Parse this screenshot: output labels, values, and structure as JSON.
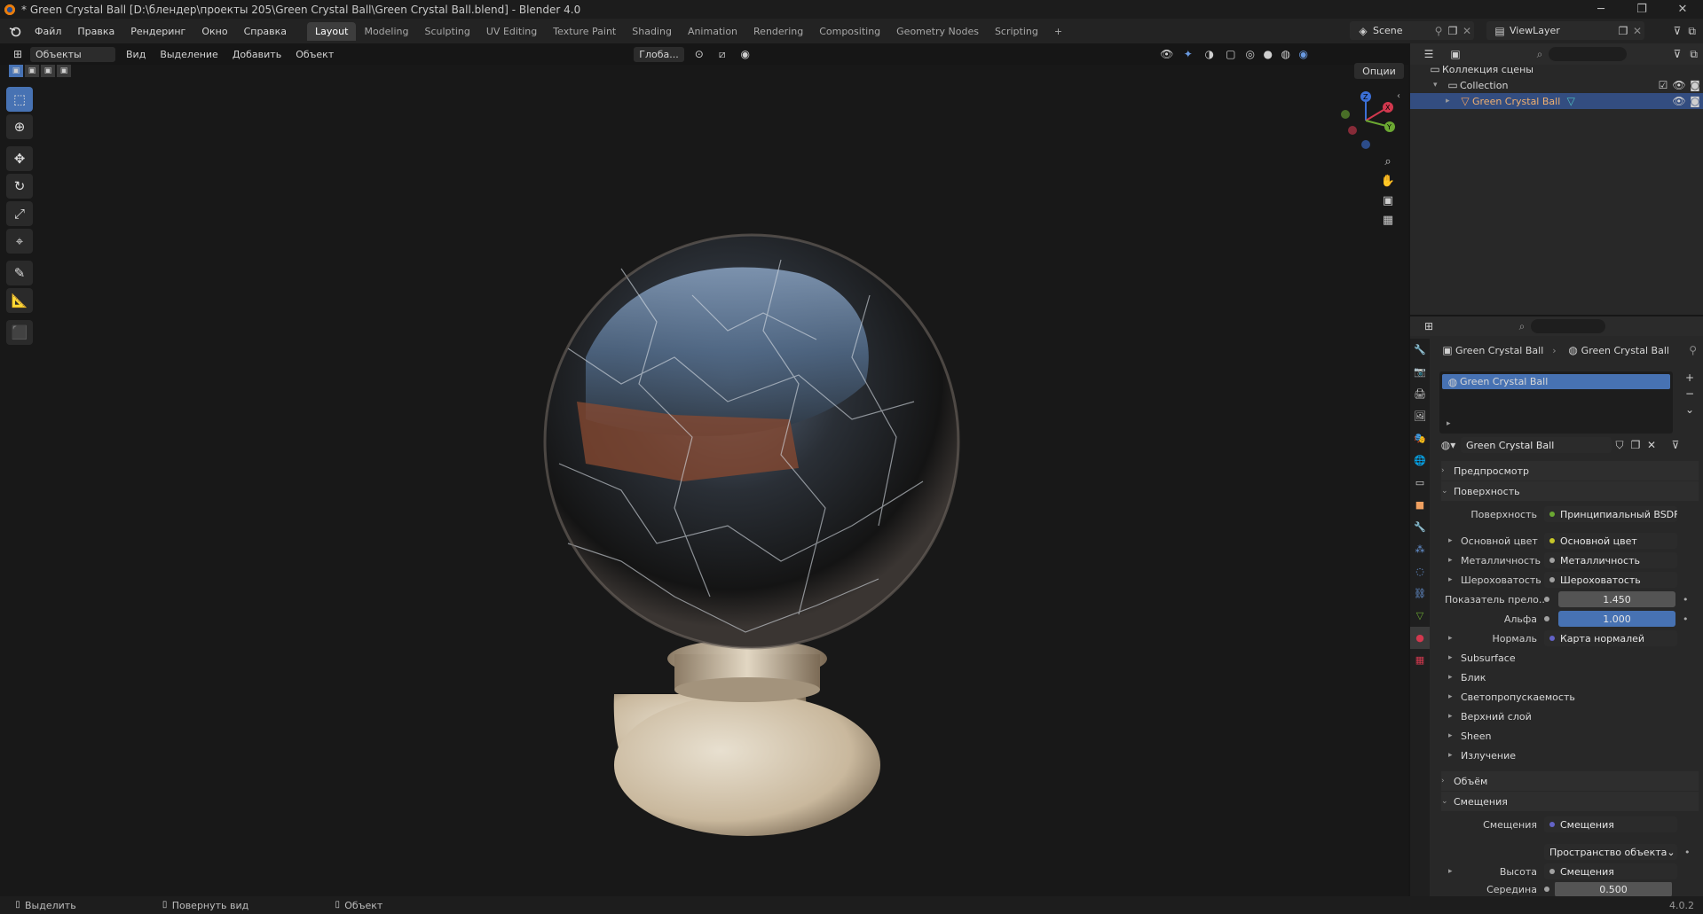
{
  "window": {
    "title": "* Green Crystal Ball [D:\\блендер\\проекты 205\\Green Crystal Ball\\Green Crystal Ball.blend] - Blender 4.0",
    "minimize": "─",
    "maximize": "❐",
    "close": "✕"
  },
  "menus": [
    "Файл",
    "Правка",
    "Рендеринг",
    "Окно",
    "Справка"
  ],
  "workspaces": [
    "Layout",
    "Modeling",
    "Sculpting",
    "UV Editing",
    "Texture Paint",
    "Shading",
    "Animation",
    "Rendering",
    "Compositing",
    "Geometry Nodes",
    "Scripting"
  ],
  "workspace_add": "+",
  "scene": "Scene",
  "view_layer": "ViewLayer",
  "viewport_header": {
    "mode": "Объекты",
    "menus": [
      "Вид",
      "Выделение",
      "Добавить",
      "Объект"
    ],
    "orientation": "Глоба...",
    "options": "Опции"
  },
  "gizmo": {
    "x": "X",
    "y": "Y",
    "z": "Z"
  },
  "outliner": {
    "scene_collection": "Коллекция сцены",
    "collection": "Collection",
    "object": "Green Crystal Ball"
  },
  "properties": {
    "breadcrumb_object": "Green Crystal Ball",
    "breadcrumb_material": "Green Crystal Ball",
    "slot": "Green Crystal Ball",
    "material_name": "Green Crystal Ball",
    "sections": {
      "preview": "Предпросмотр",
      "surface": "Поверхность",
      "volume": "Объём",
      "displacement": "Смещения"
    },
    "surface_label": "Поверхность",
    "surface_value": "Принципиальный BSDF",
    "base_color_label": "Основной цвет",
    "base_color_value": "Основной цвет",
    "metallic_label": "Металличность",
    "metallic_value": "Металличность",
    "roughness_label": "Шероховатость",
    "roughness_value": "Шероховатость",
    "ior_label": "Показатель прело...",
    "ior_value": "1.450",
    "alpha_label": "Альфа",
    "alpha_value": "1.000",
    "normal_label": "Нормаль",
    "normal_value": "Карта нормалей",
    "subpanels": [
      "Subsurface",
      "Блик",
      "Светопропускаемость",
      "Верхний слой",
      "Sheen",
      "Излучение"
    ],
    "disp_label": "Смещения",
    "disp_value": "Смещения",
    "space_value": "Пространство объекта",
    "height_label": "Высота",
    "height_value": "Смещения",
    "midlevel_label": "Середина",
    "midlevel_value": "0.500"
  },
  "status": {
    "select": "Выделить",
    "rotate": "Повернуть вид",
    "object": "Объект",
    "version": "4.0.2"
  },
  "colors": {
    "accent": "#4772b3",
    "panel": "#282828",
    "viewport": "#181818"
  }
}
